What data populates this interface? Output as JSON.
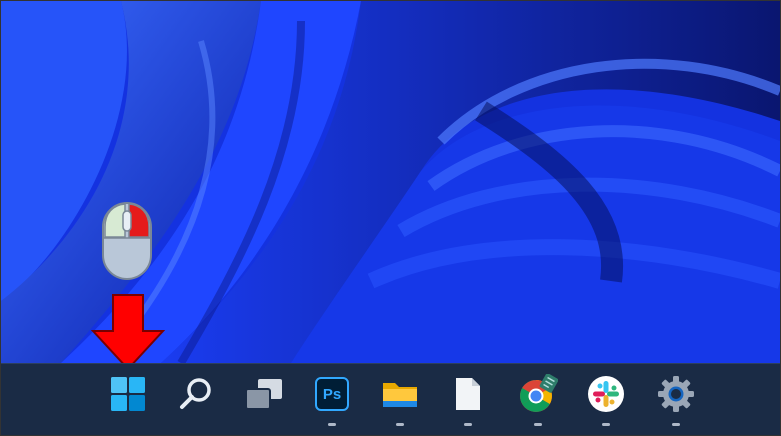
{
  "taskbar": {
    "items": [
      {
        "name": "start",
        "icon": "windows-logo-icon"
      },
      {
        "name": "search",
        "icon": "search-icon"
      },
      {
        "name": "task-view",
        "icon": "task-view-icon"
      },
      {
        "name": "photoshop",
        "icon": "photoshop-icon",
        "label": "Ps"
      },
      {
        "name": "file-explorer",
        "icon": "folder-icon"
      },
      {
        "name": "notepad",
        "icon": "document-icon"
      },
      {
        "name": "chrome",
        "icon": "chrome-icon"
      },
      {
        "name": "slack",
        "icon": "slack-icon"
      },
      {
        "name": "settings",
        "icon": "gear-icon"
      }
    ]
  },
  "colors": {
    "taskbar_bg": "#1a2b45",
    "wallpaper_blue": "#1230d8",
    "hint_arrow": "#ff0000",
    "mouse_left_button_highlight": "#e51b1b",
    "mouse_body": "#b9c7d8"
  },
  "hints": {
    "mouse_button": "left",
    "arrow_direction": "down"
  }
}
